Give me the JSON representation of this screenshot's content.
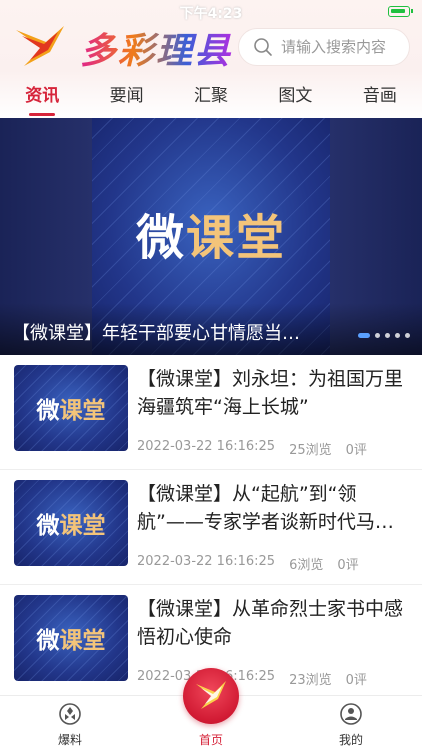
{
  "status": {
    "time": "下午4:23"
  },
  "app": {
    "name": "多彩理县"
  },
  "search": {
    "placeholder": "请输入搜索内容"
  },
  "tabs": [
    {
      "label": "资讯",
      "active": true
    },
    {
      "label": "要闻",
      "active": false
    },
    {
      "label": "汇聚",
      "active": false
    },
    {
      "label": "图文",
      "active": false
    },
    {
      "label": "音画",
      "active": false
    }
  ],
  "banner": {
    "title_part1": "微",
    "title_part2": "课堂",
    "caption": "【微课堂】年轻干部要心甘情愿当…",
    "slides": 5,
    "active_slide": 1
  },
  "thumb": {
    "part1": "微",
    "part2": "课堂"
  },
  "news": [
    {
      "title": "【微课堂】刘永坦：为祖国万里海疆筑牢“海上长城”",
      "time": "2022-03-22 16:16:25",
      "views": "25浏览",
      "comments": "0评"
    },
    {
      "title": "【微课堂】从“起航”到“领航”——专家学者谈新时代马克思主义",
      "time": "2022-03-22 16:16:25",
      "views": "6浏览",
      "comments": "0评"
    },
    {
      "title": "【微课堂】从革命烈士家书中感悟初心使命",
      "time": "2022-03-22 16:16:25",
      "views": "23浏览",
      "comments": "0评"
    }
  ],
  "bottom_nav": {
    "left_label": "爆料",
    "center_label": "首页",
    "right_label": "我的"
  },
  "colors": {
    "accent": "#d6243a",
    "banner_blue": "#22368a",
    "gold": "#f3c47a"
  }
}
